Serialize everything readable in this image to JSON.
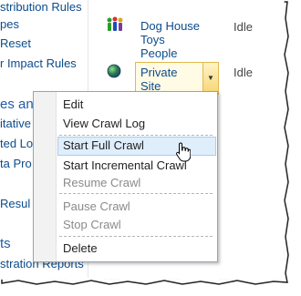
{
  "left_nav": {
    "items": [
      "stribution Rules",
      "pes",
      "Reset",
      "r Impact Rules",
      "itative",
      "ted Lo",
      "ta Pro",
      "Resul",
      "stration Reports"
    ],
    "headings": [
      "es and",
      "ts"
    ]
  },
  "rows": [
    {
      "icon": "people-icon",
      "lines": [
        "Dog House",
        "Toys",
        "People"
      ],
      "status": "Idle"
    },
    {
      "icon": "globe-icon",
      "lines": [
        "Private",
        "Site"
      ],
      "status": "Idle"
    }
  ],
  "context_menu": {
    "items": [
      {
        "label": "Edit",
        "enabled": true
      },
      {
        "label": "View Crawl Log",
        "enabled": true
      },
      {
        "label": "Start Full Crawl",
        "enabled": true,
        "highlighted": true
      },
      {
        "label": "Start Incremental Crawl",
        "enabled": true
      },
      {
        "label": "Resume Crawl",
        "enabled": false
      },
      {
        "label": "Pause Crawl",
        "enabled": false
      },
      {
        "label": "Stop Crawl",
        "enabled": false
      },
      {
        "label": "Delete",
        "enabled": true
      }
    ]
  },
  "colors": {
    "link": "#0b4c8d",
    "menu_highlight": "#dfeefb",
    "edit_box_border": "#e2b84f"
  }
}
